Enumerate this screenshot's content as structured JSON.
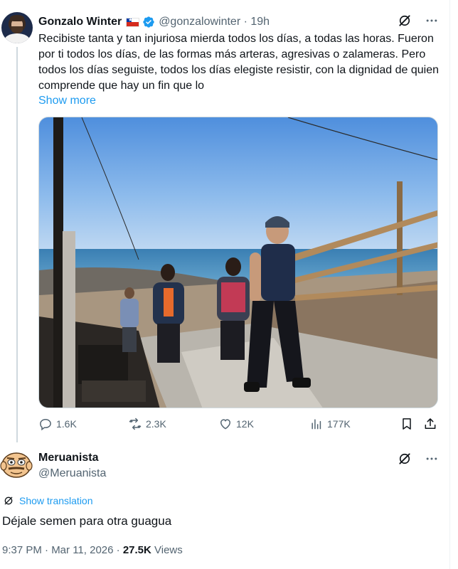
{
  "tweet": {
    "author_name": "Gonzalo Winter",
    "flag": "Chile flag",
    "handle_time": "@gonzalowinter · 19h",
    "text": "Recibiste tanta y tan injuriosa mierda todos los días, a todas las horas. Fueron por ti todos los días, de las formas más arteras, agresivas o zalameras. Pero todos los días seguiste, todos los días elegiste resistir, con la dignidad de quien comprende que hay un fin que lo",
    "show_more": "Show more",
    "photo_icon": "photo-people-walking-coast",
    "stats": {
      "replies": "1.6K",
      "reposts": "2.3K",
      "likes": "12K",
      "views": "177K"
    }
  },
  "reply": {
    "author_name": "Meruanista",
    "handle": "@Meruanista",
    "show_translation": "Show translation",
    "text": "Déjale semen para otra guagua",
    "time": "9:37 PM · Mar 11, 2026 · ",
    "views_count": "27.5K",
    "views_label": " Views"
  },
  "colors": {
    "link": "#1d9bf0",
    "secondary_text": "#536471",
    "primary_text": "#0f1419",
    "verified": "#1d9bf0"
  }
}
